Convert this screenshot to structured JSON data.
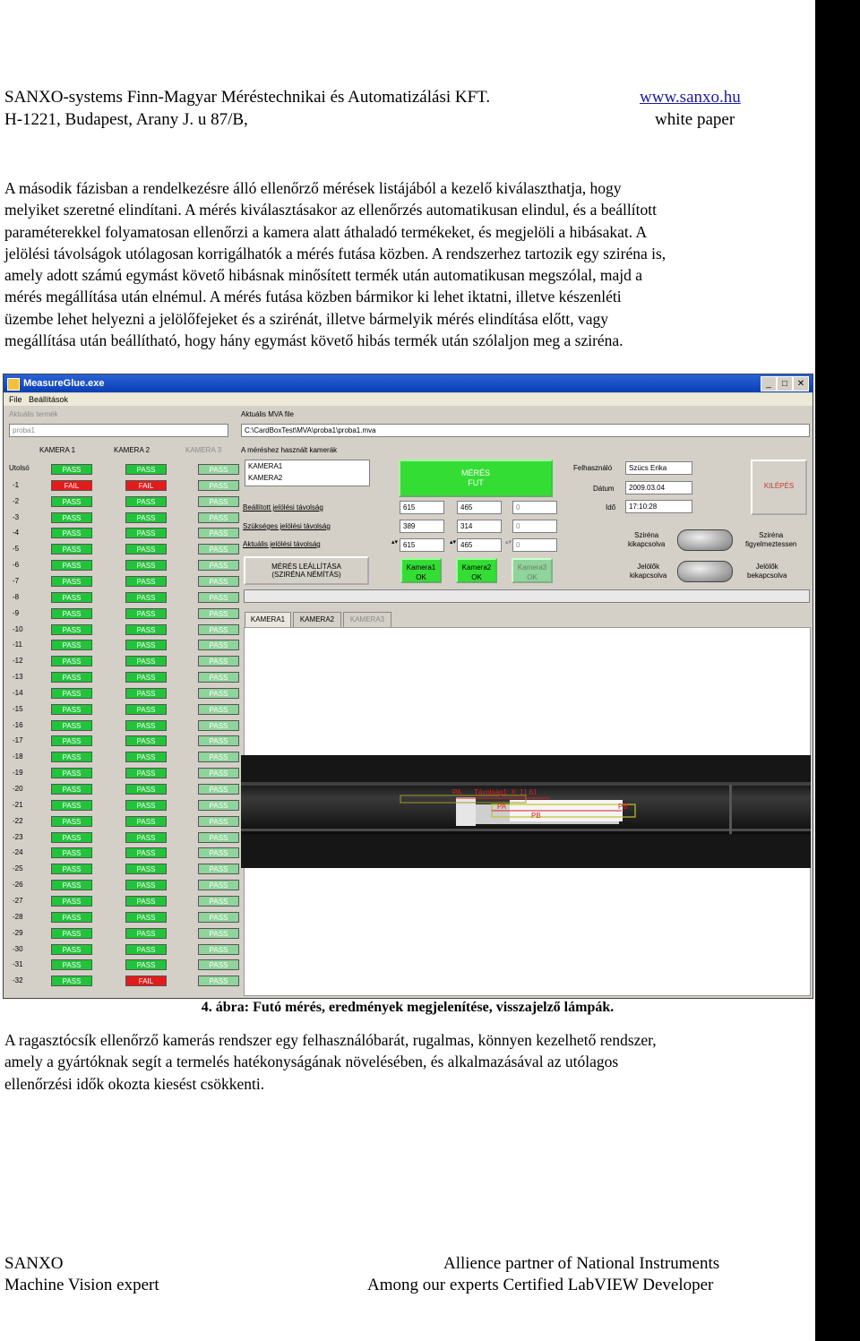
{
  "header": {
    "company": "SANXO-systems Finn-Magyar Méréstechnikai és Automatizálási KFT.",
    "address": "H-1221, Budapest, Arany J. u 87/B,",
    "website": "www.sanxo.hu",
    "doc_type": "white paper"
  },
  "paragraph1": {
    "lines": [
      "A második fázisban a rendelkezésre álló ellenőrző mérések listájából a kezelő kiválaszthatja, hogy",
      "melyiket szeretné elindítani. A mérés kiválasztásakor az ellenőrzés automatikusan elindul, és a beállított",
      "paraméterekkel folyamatosan ellenőrzi a kamera alatt áthaladó termékeket, és megjelöli a hibásakat. A",
      "jelölési távolságok utólagosan korrigálhatók a mérés futása közben. A rendszerhez tartozik egy sziréna is,",
      "amely adott számú egymást követő hibásnak minősített termék után automatikusan megszólal, majd a",
      "mérés megállítása után elnémul. A mérés futása közben bármikor ki lehet iktatni, illetve készenléti",
      "üzembe lehet helyezni a jelölőfejeket és a szirénát, illetve bármelyik mérés elindítása előtt, vagy",
      "megállítása után beállítható, hogy hány egymást követő hibás termék után szólaljon meg a sziréna."
    ]
  },
  "screenshot": {
    "window_title": "MeasureGlue.exe",
    "menu": [
      "File",
      "Beállítások"
    ],
    "current_item_label": "Aktuális termék",
    "current_item_value": "proba1",
    "current_mva_label": "Aktuális MVA file",
    "current_mva_value": "C:\\CardBoxTest\\MVA\\proba1\\proba1.mva",
    "cameras_used_label": "A méréshez használt kamerák",
    "cameras_used": [
      "KAMERA1",
      "KAMERA2"
    ],
    "col_headers": [
      "KAMERA 1",
      "KAMERA 2",
      "KAMERA 3"
    ],
    "last_label": "Utolsó",
    "rows": [
      "-1",
      "-2",
      "-3",
      "-4",
      "-5",
      "-6",
      "-7",
      "-8",
      "-9",
      "-10",
      "-11",
      "-12",
      "-13",
      "-14",
      "-15",
      "-16",
      "-17",
      "-18",
      "-19",
      "-20",
      "-21",
      "-22",
      "-23",
      "-24",
      "-25",
      "-26",
      "-27",
      "-28",
      "-29",
      "-30",
      "-31",
      "-32"
    ],
    "cam1": [
      "PASS",
      "FAIL",
      "PASS",
      "PASS",
      "PASS",
      "PASS",
      "PASS",
      "PASS",
      "PASS",
      "PASS",
      "PASS",
      "PASS",
      "PASS",
      "PASS",
      "PASS",
      "PASS",
      "PASS",
      "PASS",
      "PASS",
      "PASS",
      "PASS",
      "PASS",
      "PASS",
      "PASS",
      "PASS",
      "PASS",
      "PASS",
      "PASS",
      "PASS",
      "PASS",
      "PASS",
      "PASS",
      "PASS"
    ],
    "cam2": [
      "PASS",
      "FAIL",
      "PASS",
      "PASS",
      "PASS",
      "PASS",
      "PASS",
      "PASS",
      "PASS",
      "PASS",
      "PASS",
      "PASS",
      "PASS",
      "PASS",
      "PASS",
      "PASS",
      "PASS",
      "PASS",
      "PASS",
      "PASS",
      "PASS",
      "PASS",
      "PASS",
      "PASS",
      "PASS",
      "PASS",
      "PASS",
      "PASS",
      "PASS",
      "PASS",
      "PASS",
      "PASS",
      "FAIL"
    ],
    "cam3": [
      "PASS",
      "PASS",
      "PASS",
      "PASS",
      "PASS",
      "PASS",
      "PASS",
      "PASS",
      "PASS",
      "PASS",
      "PASS",
      "PASS",
      "PASS",
      "PASS",
      "PASS",
      "PASS",
      "PASS",
      "PASS",
      "PASS",
      "PASS",
      "PASS",
      "PASS",
      "PASS",
      "PASS",
      "PASS",
      "PASS",
      "PASS",
      "PASS",
      "PASS",
      "PASS",
      "PASS",
      "PASS",
      "PASS"
    ],
    "status_button": "MÉRÉS FUT",
    "set_distance_label": "Beállított jelölési távolság",
    "required_distance_label": "Szükséges jelölési távolság",
    "actual_distance_label": "Aktuális jelölési távolság",
    "set_values": [
      "615",
      "465",
      "0"
    ],
    "required_values": [
      "389",
      "314",
      "0"
    ],
    "actual_values": [
      "615",
      "465",
      "0"
    ],
    "stop_button_line1": "MÉRÉS LEÁLLÍTÁSA",
    "stop_button_line2": "(SZIRÉNA NÉMÍTÁS)",
    "cam_status": [
      {
        "name": "Kamera1",
        "state": "OK"
      },
      {
        "name": "Kamera2",
        "state": "OK"
      },
      {
        "name": "Kamera3",
        "state": "OK"
      }
    ],
    "user_label": "Felhasználó",
    "user_value": "Szücs Erika",
    "date_label": "Dátum",
    "date_value": "2009.03.04",
    "time_label": "Idő",
    "time_value": "17:10:28",
    "exit_button": "KILÉPÉS",
    "siren_off_line1": "Sziréna",
    "siren_off_line2": "kikapcsolva",
    "siren_watch_line1": "Sziréna",
    "siren_watch_line2": "figyelmeztessen",
    "markers_off_line1": "Jelölők",
    "markers_off_line2": "kikapcsolva",
    "markers_on_line1": "Jelölők",
    "markers_on_line2": "bekapcsolva",
    "tabs": [
      "KAMERA1",
      "KAMERA2",
      "KAMERA3"
    ],
    "overlay_labels": {
      "pa": "PA",
      "pb": "PB",
      "distance": "Távolság1: X: 11.61"
    }
  },
  "caption": "4. ábra: Futó mérés, eredmények megjelenítése, visszajelző lámpák.",
  "paragraph2": {
    "lines": [
      "A ragasztócsík ellenőrző kamerás rendszer egy felhasználóbarát, rugalmas, könnyen kezelhető rendszer,",
      "amely a gyártóknak segít a termelés hatékonyságának növelésében, és alkalmazásával az utólagos",
      "ellenőrzési idők okozta kiesést csökkenti."
    ]
  },
  "footer": {
    "left_line1": "SANXO",
    "left_line2": "Machine Vision expert",
    "right_line1": "Allience partner of National Instruments",
    "right_line2": "Among our experts Certified LabVIEW Developer"
  }
}
